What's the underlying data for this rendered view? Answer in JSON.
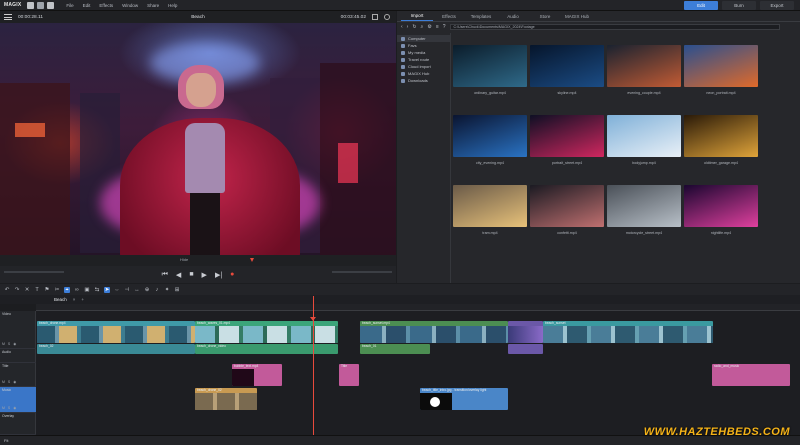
{
  "app": {
    "logo": "MAGIX",
    "menu": [
      "File",
      "Edit",
      "Effects",
      "Window",
      "Share",
      "Help"
    ],
    "modes": [
      {
        "label": "Edit",
        "active": true
      },
      {
        "label": "Burn",
        "active": false
      },
      {
        "label": "Export",
        "active": false
      }
    ]
  },
  "preview": {
    "timecode_left": "00:00:28.11",
    "title": "Beach",
    "timecode_right": "00:03:45.02",
    "scrub_label": "Hide"
  },
  "panel": {
    "tabs": [
      {
        "label": "Import",
        "active": true
      },
      {
        "label": "Effects",
        "active": false
      },
      {
        "label": "Templates",
        "active": false
      },
      {
        "label": "Audio",
        "active": false
      },
      {
        "label": "Store",
        "active": false
      },
      {
        "label": "MAGIX Hub",
        "active": false
      }
    ],
    "path": "C:\\Users\\Chuck\\Documents\\MAGIX_2024\\Footage",
    "sidebar": [
      {
        "label": "Computer",
        "active": true
      },
      {
        "label": "Favs",
        "active": false
      },
      {
        "label": "My media",
        "active": false
      },
      {
        "label": "Travel route",
        "active": false
      },
      {
        "label": "Cloud import",
        "active": false
      },
      {
        "label": "MAGIX Hub",
        "active": false
      },
      {
        "label": "Downloads",
        "active": false
      }
    ],
    "media": [
      {
        "name": "ordinary_guitar.mp4",
        "colors": [
          "#0b1c2a",
          "#2f6a8a"
        ]
      },
      {
        "name": "skyline.mp4",
        "colors": [
          "#06152b",
          "#1b4c85"
        ]
      },
      {
        "name": "evening_couple.mp4",
        "colors": [
          "#1a2230",
          "#c25b34"
        ]
      },
      {
        "name": "neon_portrait.mp4",
        "colors": [
          "#2a4f8f",
          "#e06a2a"
        ]
      },
      {
        "name": "city_evening.mp4",
        "colors": [
          "#0a1430",
          "#2a73c4"
        ]
      },
      {
        "name": "portrait_street.mp4",
        "colors": [
          "#0e0f24",
          "#d0275f"
        ]
      },
      {
        "name": "bodyjump.mp4",
        "colors": [
          "#7fb0d8",
          "#e9f0f7"
        ]
      },
      {
        "name": "oldtimer_garage.mp4",
        "colors": [
          "#2a1a08",
          "#e0a43a"
        ]
      },
      {
        "name": "tram.mp4",
        "colors": [
          "#6a5a48",
          "#e8c27a"
        ]
      },
      {
        "name": "confetti.mp4",
        "colors": [
          "#1b1a22",
          "#c07070"
        ]
      },
      {
        "name": "motorcycle_street.mp4",
        "colors": [
          "#4a5058",
          "#b8c0c8"
        ]
      },
      {
        "name": "nightlife.mp4",
        "colors": [
          "#1a0630",
          "#e0409e"
        ]
      }
    ]
  },
  "timeline": {
    "tab": "Beach",
    "tracks": [
      {
        "name": "Video"
      },
      {
        "name": "Audio"
      },
      {
        "name": "Title"
      },
      {
        "name": "Music"
      },
      {
        "name": "Overlay"
      }
    ],
    "clip_labels": {
      "a": "beach_drone.mp4",
      "b": "beach_waves_01.mp4",
      "c": "beach_sunset.mp4",
      "d": "beach_drone_video",
      "e": "beach_02",
      "f": "beach_walk",
      "g": "beach_01",
      "h": "beach_sunset",
      "i": "beach_people",
      "j": "beach_family",
      "k": "sunset_02",
      "l": "beach_waves_02",
      "m": "beach_drone_02",
      "n": "bubble_text.mp4",
      "o": "Title",
      "p": "radio_and_music",
      "q": "beach_title_intro.jpg - transition/overlay light"
    },
    "zoom": "Fit"
  },
  "watermark": "WWW.HAZTEHBEDS.COM"
}
